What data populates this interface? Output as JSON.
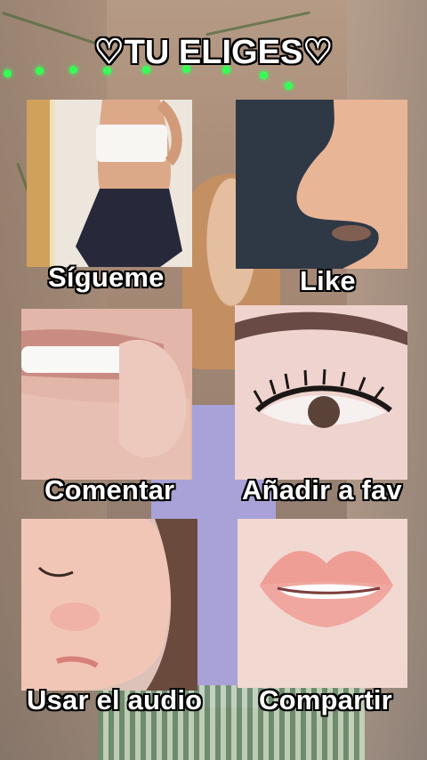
{
  "header": {
    "title": "♡TU ELIGES♡"
  },
  "options": [
    {
      "label": "Sígueme",
      "image": "torso-photo"
    },
    {
      "label": "Like",
      "image": "nose-photo"
    },
    {
      "label": "Comentar",
      "image": "teeth-photo"
    },
    {
      "label": "Añadir a fav",
      "image": "eye-lashes-photo"
    },
    {
      "label": "Usar el audio",
      "image": "face-profile-photo"
    },
    {
      "label": "Compartir",
      "image": "lips-photo"
    }
  ]
}
